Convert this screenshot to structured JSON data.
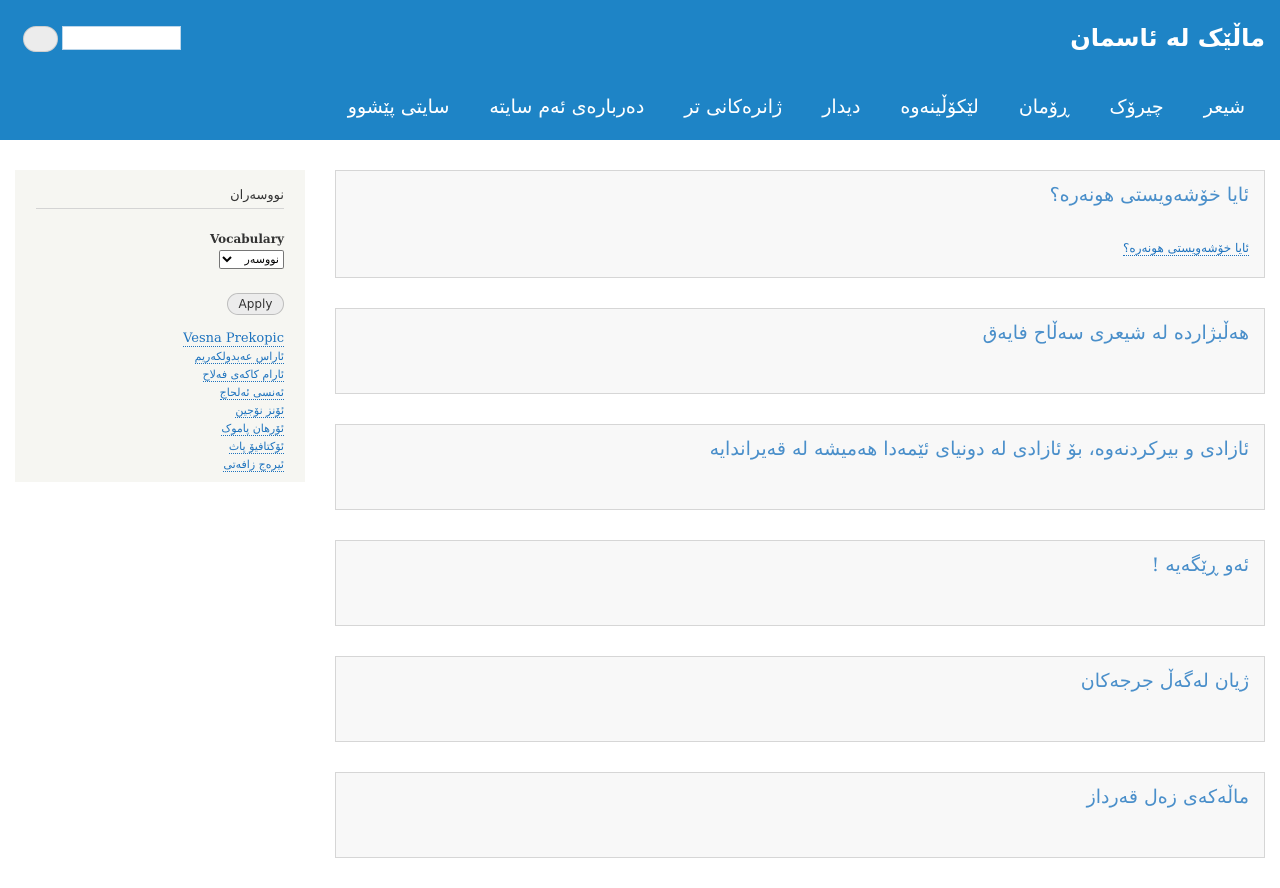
{
  "header": {
    "site_title": "ماڵێک لە ئاسمان",
    "search": {
      "value": "",
      "placeholder": ""
    },
    "search_button_label": "",
    "nav": [
      "شیعر",
      "چیرۆک",
      "ڕۆمان",
      "لێکۆڵینەوە",
      "دیدار",
      "ژانرەکانی تر",
      "دەربارەی ئەم سایتە",
      "سایتی پێشوو"
    ]
  },
  "sidebar": {
    "block_title": "نووسەران",
    "vocab_label": "Vocabulary",
    "vocab_selected": "نووسەر",
    "apply_label": "Apply",
    "authors": [
      "Vesna Prekopic",
      "ئاراس عەبدولکەریم",
      "ئارام کاکەی فەلاح",
      "ئەنسی ئەلحاج",
      "ئۆنز نۆجین",
      "ئۆرهان پاموک",
      "ئۆکتافیۆ پاث",
      "ئیرەج زافەتی"
    ]
  },
  "posts": [
    {
      "title": "ئایا خۆشەویستی هونەرە؟",
      "link": "ئایا خۆشەویستی هونەرە؟"
    },
    {
      "title": "هەڵبژاردە لە شیعری سەڵاح فایەق"
    },
    {
      "title": "ئازادی و بیرکردنەوە، بۆ ئازادی لە دونیای ئێمەدا هەمیشە لە قەیراندایە"
    },
    {
      "title": "ئەو ڕێگەیە !"
    },
    {
      "title": "ژیان لەگەڵ جرجەکان"
    },
    {
      "title": "ماڵەکەی زەل قەرداز"
    }
  ]
}
